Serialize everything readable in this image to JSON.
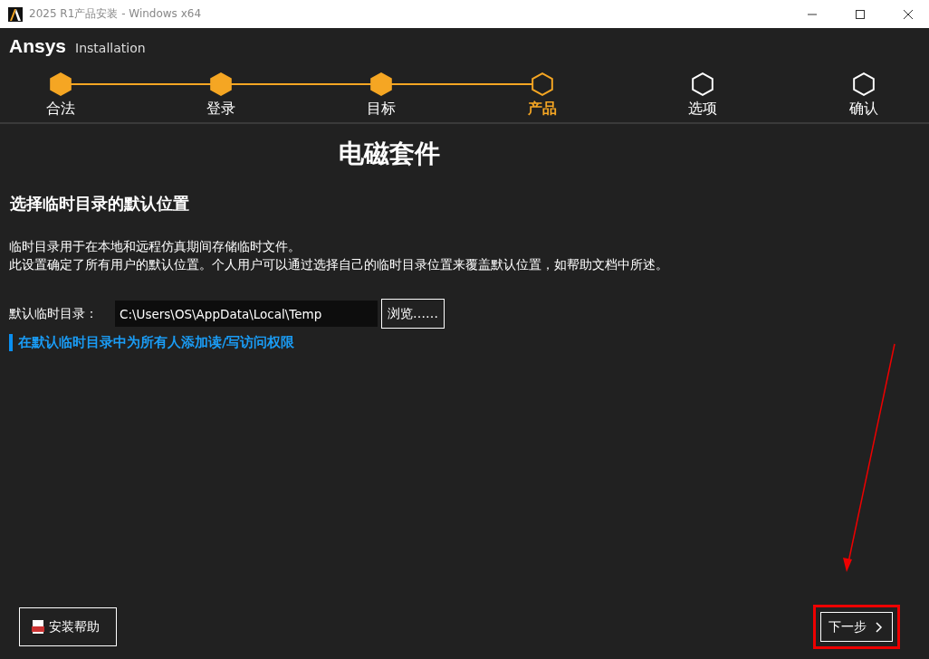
{
  "window": {
    "title": "2025 R1产品安装 - Windows x64"
  },
  "header": {
    "brand": "Ansys",
    "subtitle": "Installation"
  },
  "steps": [
    {
      "label": "合法",
      "completed": true,
      "selected": false
    },
    {
      "label": "登录",
      "completed": true,
      "selected": false
    },
    {
      "label": "目标",
      "completed": true,
      "selected": false
    },
    {
      "label": "产品",
      "completed": false,
      "selected": true
    },
    {
      "label": "选项",
      "completed": false,
      "selected": false
    },
    {
      "label": "确认",
      "completed": false,
      "selected": false
    }
  ],
  "page_title": "电磁套件",
  "section_title": "选择临时目录的默认位置",
  "description": [
    "临时目录用于在本地和远程仿真期间存储临时文件。",
    "此设置确定了所有用户的默认位置。个人用户可以通过选择自己的临时目录位置来覆盖默认位置，如帮助文档中所述。"
  ],
  "temp_dir": {
    "label": "默认临时目录：",
    "value": "C:\\Users\\OS\\AppData\\Local\\Temp",
    "browse": "浏览……"
  },
  "permission_link": "在默认临时目录中为所有人添加读/写访问权限",
  "footer": {
    "help": "安装帮助",
    "next": "下一步"
  }
}
